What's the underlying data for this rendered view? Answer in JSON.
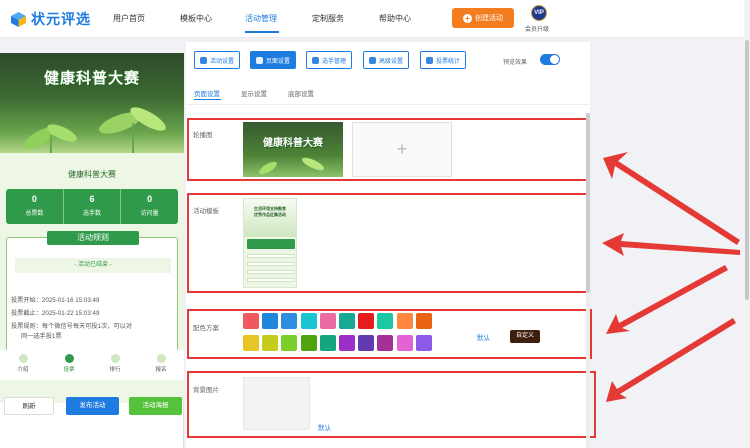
{
  "brand": {
    "name": "状元评选"
  },
  "nav": {
    "items": [
      "用户首页",
      "模板中心",
      "活动管理",
      "定制服务",
      "帮助中心"
    ],
    "create_label": "创建活动",
    "vip_badge": "VIP",
    "vip_label": "会员升级"
  },
  "preview": {
    "banner_title": "健康科普大赛",
    "subtitle": "健康科普大赛",
    "stats": [
      {
        "value": "0",
        "label": "总票数"
      },
      {
        "value": "6",
        "label": "选手数"
      },
      {
        "value": "0",
        "label": "访问量"
      }
    ],
    "rules_title": "活动规则",
    "ended_text": "- 活动已结束 -",
    "vote_start": "投票开始：2025-01-16 15:03:49",
    "vote_end": "投票截止：2025-01-22 15:03:49",
    "vote_rule_1": "投票规则：每个微信号每天可投1次，可以对",
    "vote_rule_2": "同一选手投1票",
    "bottom_tabs": [
      "介绍",
      "投票",
      "排行",
      "报名"
    ],
    "active_tab_index": 1,
    "actions": {
      "refresh": "刷新",
      "publish": "发布活动",
      "poster": "活动海报"
    }
  },
  "toolbar": {
    "buttons": [
      "活动设置",
      "页面设置",
      "选手管理",
      "高级设置",
      "投票统计"
    ],
    "active_index": 1,
    "preset_label": "预览效果",
    "preset_on": true
  },
  "subtabs": [
    "页面设置",
    "显示设置",
    "底部设置"
  ],
  "sections": {
    "carousel_label": "轮播图",
    "carousel_image_text": "健康科普大赛",
    "upload_plus": "+",
    "template_label": "活动模板",
    "template_lines": [
      "生活环境支持教育",
      "优秀作品征集活动"
    ],
    "color_label": "配色方案",
    "default_label": "默认",
    "custom_label": "自定义",
    "bg_label": "背景图片",
    "bg_default_label": "默认"
  },
  "colors": {
    "accent": "#1e7be0",
    "orange": "#f47d20",
    "green": "#2f9b4a",
    "annotation_red": "#e53935",
    "palette_row1": [
      "#ef5a5f",
      "#1f86d9",
      "#2f8ee0",
      "#1cc3d1",
      "#ea6aa2",
      "#17a994",
      "#e51d1d",
      "#1cc8a3",
      "#ff8740",
      "#e86212"
    ],
    "palette_row2": [
      "#e7c624",
      "#c4cd1b",
      "#7ccf2b",
      "#4ea30f",
      "#14a57c",
      "#9c2fc5",
      "#623ab1",
      "#a53097",
      "#e463d4",
      "#8b5ae6"
    ]
  }
}
